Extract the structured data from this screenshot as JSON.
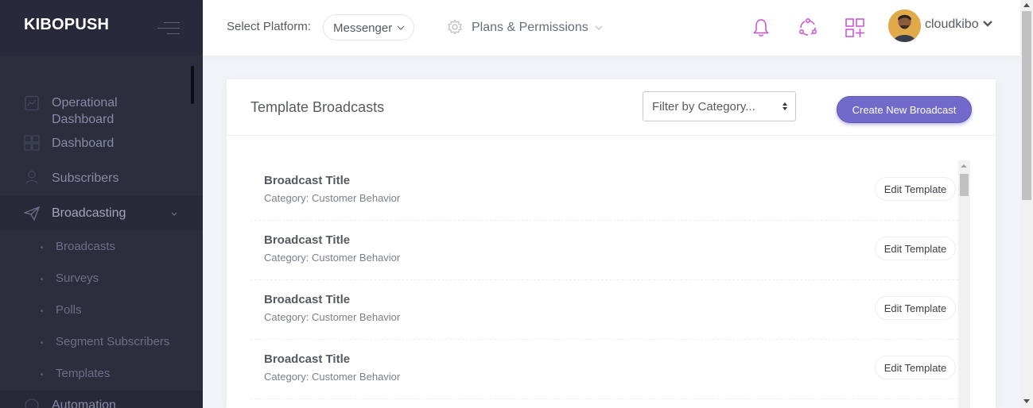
{
  "brand": {
    "title": "KIBOPUSH"
  },
  "sidebar": {
    "items": [
      {
        "label": "Operational Dashboard",
        "icon": "clipboard-chart-icon"
      },
      {
        "label": "Dashboard",
        "icon": "grid-icon"
      },
      {
        "label": "Subscribers",
        "icon": "user-icon"
      },
      {
        "label": "Broadcasting",
        "icon": "paper-plane-icon",
        "expanded": true
      },
      {
        "label": "Automation",
        "icon": "automation-icon"
      }
    ],
    "broadcasting_sub": [
      {
        "label": "Broadcasts"
      },
      {
        "label": "Surveys"
      },
      {
        "label": "Polls"
      },
      {
        "label": "Segment Subscribers"
      },
      {
        "label": "Templates"
      }
    ]
  },
  "header": {
    "platform_label": "Select Platform:",
    "platform_value": "Messenger",
    "plans_label": "Plans & Permissions",
    "user_name": "cloudkibo",
    "icons": [
      "bell-icon",
      "share-icon",
      "apps-add-icon"
    ]
  },
  "colors": {
    "accent": "#716aca",
    "icon_pink": "#c94fd1",
    "sidebar_bg": "#2c2e3e"
  },
  "main": {
    "title": "Template Broadcasts",
    "filter_placeholder": "Filter by Category...",
    "create_button": "Create New Broadcast",
    "broadcasts": [
      {
        "title": "Broadcast Title",
        "category": "Category: Customer Behavior",
        "action": "Edit Template"
      },
      {
        "title": "Broadcast Title",
        "category": "Category: Customer Behavior",
        "action": "Edit Template"
      },
      {
        "title": "Broadcast Title",
        "category": "Category: Customer Behavior",
        "action": "Edit Template"
      },
      {
        "title": "Broadcast Title",
        "category": "Category: Customer Behavior",
        "action": "Edit Template"
      }
    ]
  }
}
